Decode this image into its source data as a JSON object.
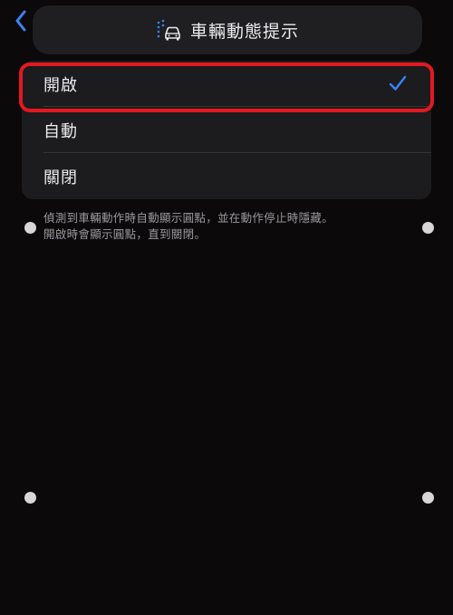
{
  "header": {
    "title": "車輛動態提示",
    "title_icon": "vehicle-motion-cues-icon",
    "back_icon": "chevron-left-icon"
  },
  "options": [
    {
      "label": "開啟",
      "selected": true
    },
    {
      "label": "自動",
      "selected": false
    },
    {
      "label": "關閉",
      "selected": false
    }
  ],
  "footnote": {
    "line1": "偵測到車輛動作時自動顯示圓點，並在動作停止時隱藏。",
    "line2": "開啟時會顯示圓點，直到關閉。"
  },
  "colors": {
    "accent": "#3a82f7",
    "highlight": "#e3191f",
    "background": "#0b0909",
    "group_bg": "#1c1b1e"
  },
  "motion_dots": {
    "count": 4,
    "color": "#d7d7da"
  }
}
